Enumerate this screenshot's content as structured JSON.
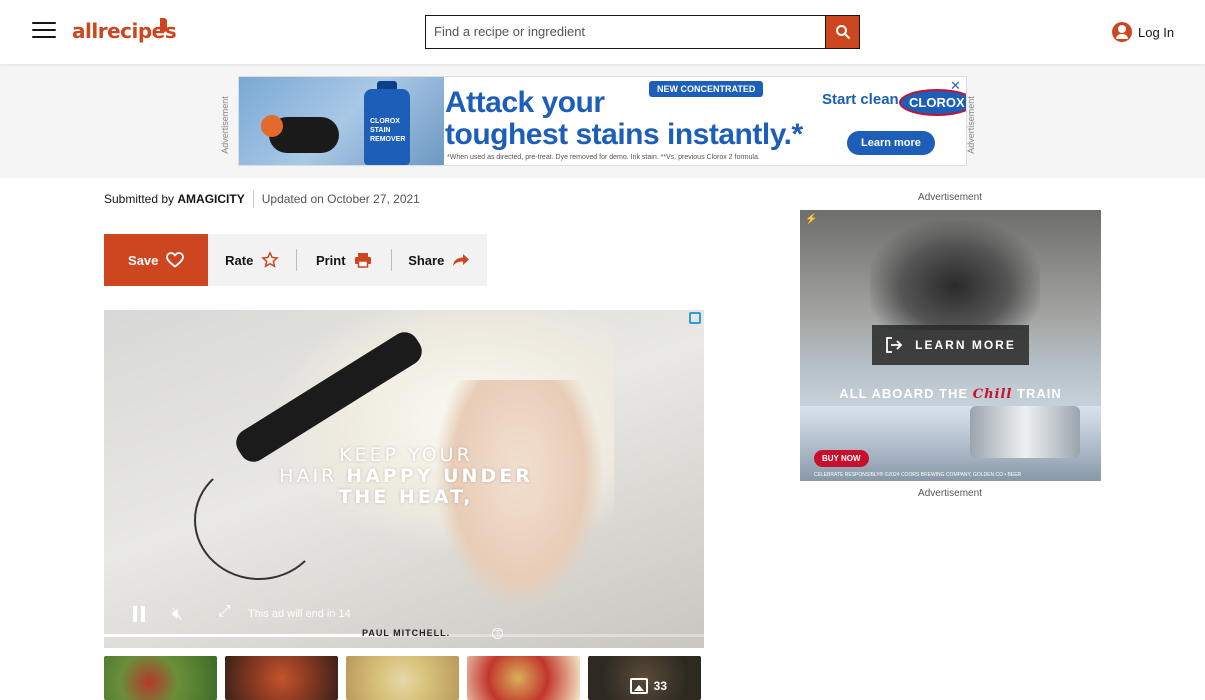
{
  "header": {
    "logo_text": "allrecipes",
    "search_placeholder": "Find a recipe or ingredient",
    "login_label": "Log In",
    "brand_color": "#ce4620"
  },
  "top_ad": {
    "side_label": "Advertisement",
    "headline_line1": "Attack your",
    "headline_line2": "toughest stains instantly.*",
    "badge": "NEW CONCENTRATED",
    "tagline": "Start clean.",
    "brand": "CLOROX",
    "bottle_label": "CLOROX STAIN REMOVER",
    "cta": "Learn more",
    "fine_print": "*When used as directed, pre-treat. Dye removed for demo. Ink stain. **Vs. previous Clorox 2 formula.",
    "close": "✕"
  },
  "byline": {
    "submitted_prefix": "Submitted by",
    "author": "AMAGICITY",
    "updated": "Updated on October 27, 2021"
  },
  "actions": {
    "save": "Save",
    "rate": "Rate",
    "print": "Print",
    "share": "Share"
  },
  "video_ad": {
    "line1": "KEEP YOUR",
    "line2_prefix": "HAIR",
    "line2_bold": "HAPPY UNDER",
    "line3": "THE HEAT,",
    "countdown": "This ad will end in 14",
    "brand": "PAUL MITCHELL.",
    "progress": 0.46,
    "help": "?"
  },
  "gallery": {
    "photo_count": "33"
  },
  "side_ad": {
    "label_top": "Advertisement",
    "label_bottom": "Advertisement",
    "cta": "LEARN MORE",
    "headline_prefix": "ALL ABOARD THE",
    "headline_brand": "Chill",
    "headline_suffix": "TRAIN",
    "buy": "BUY NOW",
    "fine_print": "CELEBRATE RESPONSIBLY® ©2024 COORS BREWING COMPANY, GOLDEN CO • BEER",
    "bolt": "⚡"
  }
}
